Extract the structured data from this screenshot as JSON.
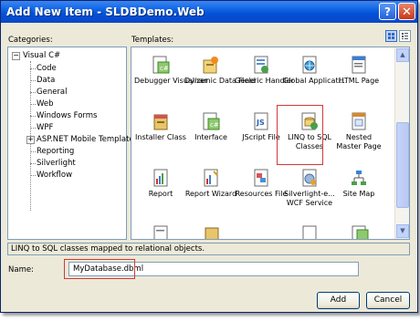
{
  "window": {
    "title": "Add New Item - SLDBDemo.Web",
    "help_glyph": "?",
    "close_glyph": "✕"
  },
  "categories": {
    "label": "Categories:",
    "root": "Visual C#",
    "items": [
      "Code",
      "Data",
      "General",
      "Web",
      "Windows Forms",
      "WPF",
      "ASP.NET Mobile Templates",
      "Reporting",
      "Silverlight",
      "Workflow"
    ]
  },
  "templates": {
    "label": "Templates:",
    "items": [
      {
        "label": "Debugger Visualizer",
        "icon": "csharp-class-icon"
      },
      {
        "label": "Dynamic Data Field",
        "icon": "dynamic-data-icon"
      },
      {
        "label": "Generic Handler",
        "icon": "handler-icon"
      },
      {
        "label": "Global Applicati...",
        "icon": "global-app-icon"
      },
      {
        "label": "HTML Page",
        "icon": "html-page-icon"
      },
      {
        "label": "Installer Class",
        "icon": "installer-icon"
      },
      {
        "label": "Interface",
        "icon": "interface-icon"
      },
      {
        "label": "JScript File",
        "icon": "jscript-icon"
      },
      {
        "label": "LINQ to SQL Classes",
        "icon": "linq-sql-icon"
      },
      {
        "label": "Nested Master Page",
        "icon": "master-page-icon"
      },
      {
        "label": "Report",
        "icon": "report-icon"
      },
      {
        "label": "Report Wizard",
        "icon": "report-wizard-icon"
      },
      {
        "label": "Resources File",
        "icon": "resources-icon"
      },
      {
        "label": "Silverlight-e... WCF Service",
        "icon": "silverlight-wcf-icon"
      },
      {
        "label": "Site Map",
        "icon": "sitemap-icon"
      }
    ],
    "selected": "LINQ to SQL Classes"
  },
  "description": "LINQ to SQL classes mapped to relational objects.",
  "name": {
    "label": "Name:",
    "value": "MyDatabase.dbml"
  },
  "buttons": {
    "add": "Add",
    "cancel": "Cancel"
  },
  "colors": {
    "titlebar": "#0a5fe0",
    "highlight": "#d03a3a",
    "dialog_bg": "#ece9d8"
  }
}
